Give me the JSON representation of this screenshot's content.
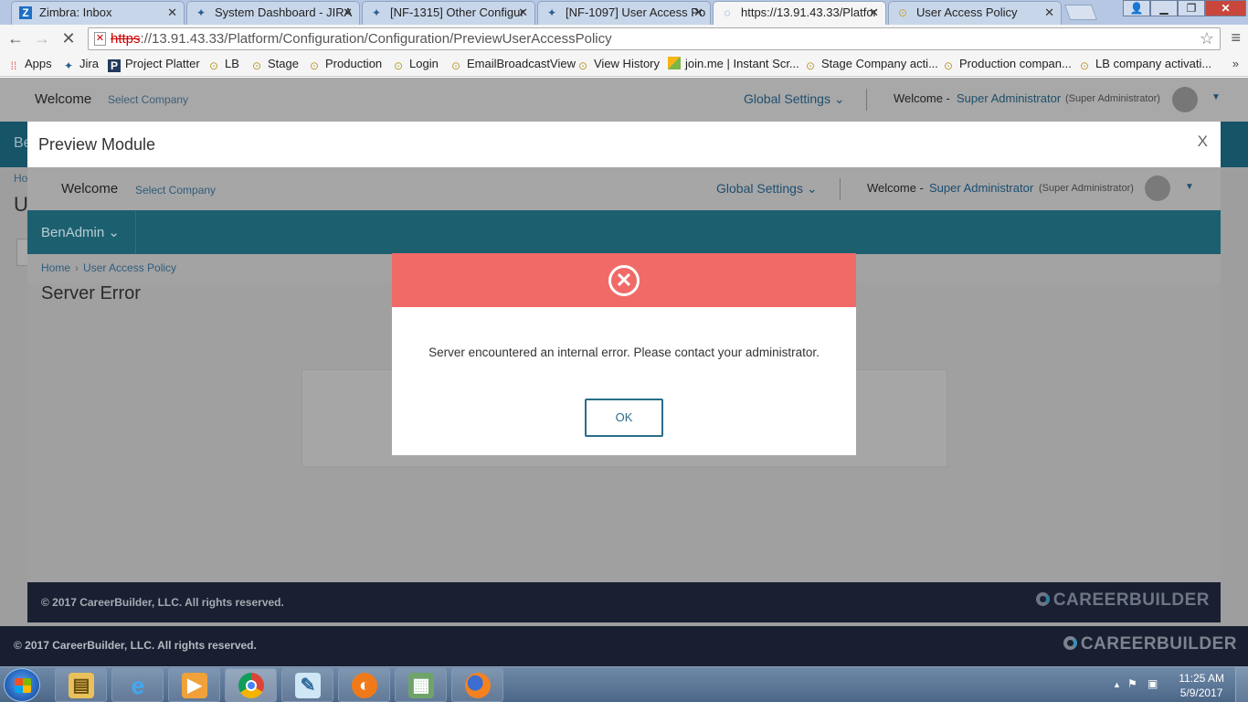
{
  "browser": {
    "tabs": [
      {
        "title": "Zimbra: Inbox",
        "icon": "zimbra-icon",
        "active": false
      },
      {
        "title": "System Dashboard - JIRA",
        "icon": "jira-icon",
        "active": false
      },
      {
        "title": "[NF-1315] Other Configur",
        "icon": "jira-icon",
        "active": false
      },
      {
        "title": "[NF-1097] User Access Po",
        "icon": "jira-icon",
        "active": false
      },
      {
        "title": "https://13.91.43.33/Platfor",
        "icon": "loading-icon",
        "active": true
      },
      {
        "title": "User Access Policy",
        "icon": "site-icon",
        "active": false
      }
    ],
    "url_scheme": "https",
    "url_rest": "://13.91.43.33/Platform/Configuration/Configuration/PreviewUserAccessPolicy",
    "bookmarks": [
      {
        "label": "Apps",
        "icon": "apps-grid-icon"
      },
      {
        "label": "Jira",
        "icon": "jira-icon"
      },
      {
        "label": "Project Platter",
        "icon": "p-icon"
      },
      {
        "label": "LB",
        "icon": "site-icon"
      },
      {
        "label": "Stage",
        "icon": "site-icon"
      },
      {
        "label": "Production",
        "icon": "site-icon"
      },
      {
        "label": "Login",
        "icon": "site-icon"
      },
      {
        "label": "EmailBroadcastView",
        "icon": "site-icon"
      },
      {
        "label": "View History",
        "icon": "site-icon"
      },
      {
        "label": "join.me | Instant Scr...",
        "icon": "joinme-icon"
      },
      {
        "label": "Stage Company acti...",
        "icon": "site-icon"
      },
      {
        "label": "Production compan...",
        "icon": "site-icon"
      },
      {
        "label": "LB company activati...",
        "icon": "site-icon"
      }
    ],
    "bookmarks_more": "»"
  },
  "page": {
    "welcome": "Welcome",
    "select_company": "Select Company",
    "global_settings": "Global Settings",
    "welcome_prefix": "Welcome -",
    "user_name": "Super Administrator",
    "user_role": "(Super Administrator)",
    "band_text": "Be",
    "breadcrumb": "Ho",
    "title": "U",
    "footer": "© 2017 CareerBuilder, LLC. All rights reserved.",
    "logo": "CAREERBUILDER"
  },
  "modal": {
    "title": "Preview Module",
    "close": "X",
    "inner": {
      "welcome": "Welcome",
      "select_company": "Select Company",
      "global_settings": "Global Settings",
      "welcome_prefix": "Welcome -",
      "user_name": "Super Administrator",
      "user_role": "(Super Administrator)",
      "menu": "BenAdmin",
      "breadcrumb_home": "Home",
      "breadcrumb_current": "User Access Policy",
      "title": "Server Error",
      "footer": "© 2017 CareerBuilder, LLC. All rights reserved.",
      "logo": "CAREERBUILDER"
    }
  },
  "error_dialog": {
    "message": "Server encountered an internal error. Please contact your administrator.",
    "ok_label": "OK",
    "header_color": "#f06a67"
  },
  "taskbar": {
    "apps": [
      "file-explorer-icon",
      "internet-explorer-icon",
      "media-player-icon",
      "chrome-icon",
      "notepad-icon",
      "ftp-client-icon",
      "calculator-icon",
      "firefox-icon"
    ],
    "time": "11:25 AM",
    "date": "5/9/2017"
  }
}
